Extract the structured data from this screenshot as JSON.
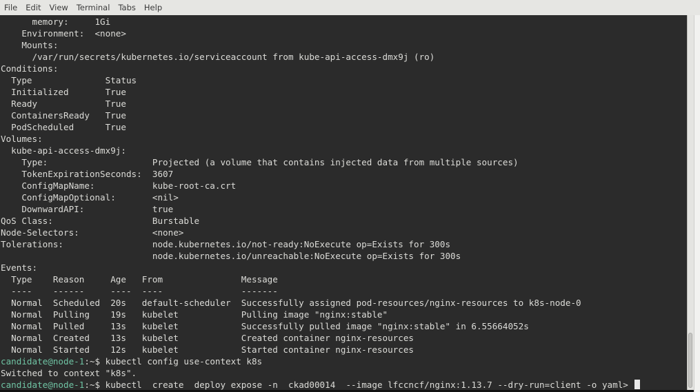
{
  "menu": {
    "items": [
      "File",
      "Edit",
      "View",
      "Terminal",
      "Tabs",
      "Help"
    ]
  },
  "terminal": {
    "lines": [
      {
        "text": "      memory:     1Gi"
      },
      {
        "text": "    Environment:  <none>"
      },
      {
        "text": "    Mounts:"
      },
      {
        "text": "      /var/run/secrets/kubernetes.io/serviceaccount from kube-api-access-dmx9j (ro)"
      },
      {
        "text": "Conditions:"
      },
      {
        "text": "  Type              Status"
      },
      {
        "text": "  Initialized       True"
      },
      {
        "text": "  Ready             True"
      },
      {
        "text": "  ContainersReady   True"
      },
      {
        "text": "  PodScheduled      True"
      },
      {
        "text": "Volumes:"
      },
      {
        "text": "  kube-api-access-dmx9j:"
      },
      {
        "text": "    Type:                    Projected (a volume that contains injected data from multiple sources)"
      },
      {
        "text": "    TokenExpirationSeconds:  3607"
      },
      {
        "text": "    ConfigMapName:           kube-root-ca.crt"
      },
      {
        "text": "    ConfigMapOptional:       <nil>"
      },
      {
        "text": "    DownwardAPI:             true"
      },
      {
        "text": "QoS Class:                   Burstable"
      },
      {
        "text": "Node-Selectors:              <none>"
      },
      {
        "text": "Tolerations:                 node.kubernetes.io/not-ready:NoExecute op=Exists for 300s"
      },
      {
        "text": "                             node.kubernetes.io/unreachable:NoExecute op=Exists for 300s"
      },
      {
        "text": "Events:"
      },
      {
        "text": "  Type    Reason     Age   From               Message"
      },
      {
        "text": "  ----    ------     ----  ----               -------"
      },
      {
        "text": "  Normal  Scheduled  20s   default-scheduler  Successfully assigned pod-resources/nginx-resources to k8s-node-0"
      },
      {
        "text": "  Normal  Pulling    19s   kubelet            Pulling image \"nginx:stable\""
      },
      {
        "text": "  Normal  Pulled     13s   kubelet            Successfully pulled image \"nginx:stable\" in 6.55664052s"
      },
      {
        "text": "  Normal  Created    13s   kubelet            Created container nginx-resources"
      },
      {
        "text": "  Normal  Started    12s   kubelet            Started container nginx-resources"
      },
      {
        "prompt": "candidate@node-1",
        "suffix": ":~$ ",
        "command": "kubectl config use-context k8s"
      },
      {
        "text": "Switched to context \"k8s\"."
      },
      {
        "prompt": "candidate@node-1",
        "suffix": ":~$ ",
        "command": "kubectl  create  deploy expose -n  ckad00014  --image lfccncf/nginx:1.13.7 --dry-run=client -o yaml> ",
        "cursor": true
      }
    ]
  },
  "colors": {
    "background": "#2b2b2b",
    "text": "#dcdcd8",
    "prompt": "#6fc3a3"
  }
}
